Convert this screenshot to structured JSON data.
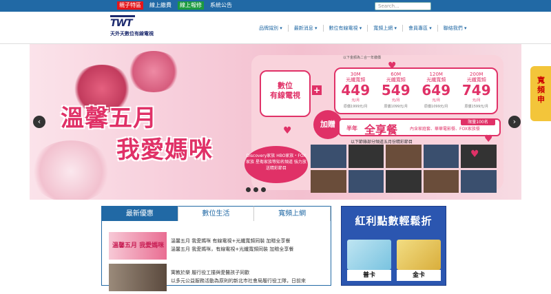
{
  "topbar": {
    "links": [
      "親子特區",
      "線上繳費",
      "線上報修",
      "系統公告"
    ],
    "search_placeholder": "Search..."
  },
  "header": {
    "logo_mark": "TWT",
    "logo_text": "天外天數位有線電視"
  },
  "nav": {
    "items": [
      "品牌識別 ▾",
      "最新消息 ▾",
      "數位有線電視 ▾",
      "寬頻上網 ▾",
      "會員專區 ▾",
      "聯絡我們 ▾"
    ]
  },
  "banner": {
    "title_line1": "溫馨五月",
    "title_line2": "我愛媽咪",
    "price_note": "以下金額為二合一年繳價",
    "digital_label_line1": "數位",
    "digital_label_line2": "有線電視",
    "plus": "+",
    "plans": [
      {
        "speed": "30M",
        "label": "光纖寬頻",
        "price": "449",
        "unit": "元/月",
        "orig": "原價1999元/月"
      },
      {
        "speed": "60M",
        "label": "光纖寬頻",
        "price": "549",
        "unit": "元/月",
        "orig": "原價1099元/月"
      },
      {
        "speed": "120M",
        "label": "光纖寬頻",
        "price": "649",
        "unit": "元/月",
        "orig": "原價1099元/月"
      },
      {
        "speed": "200M",
        "label": "光纖寬頻",
        "price": "749",
        "unit": "元/月",
        "orig": "原價1599元/月"
      }
    ],
    "gift": "加贈",
    "half_year": "半年",
    "package_name": "全享餐",
    "package_desc": "內含家庭套、華華電影餐、FOX家族餐",
    "limited": "限量100名",
    "channel_note": "以下節錄部分頻道五月份精彩節目",
    "discovery_text": "Discovery家族 HBO家族・FOX家族 星衛家族等知名頻道 強力放送精彩節目",
    "side_tab": "寬頻申"
  },
  "tabs": {
    "items": [
      "最新優惠",
      "數位生活",
      "寬頻上網"
    ]
  },
  "news": [
    {
      "thumb_text": "溫馨五月 我愛媽咪",
      "title": "溫馨五月 我愛媽咪 有線電視+光纖寬頻同裝 加贈全享餐",
      "desc": "溫馨五月 我愛媽咪，有線電視+光纖寬頻同裝 加贈全享餐"
    },
    {
      "thumb_text": "",
      "title": "寓教於樂 履行役工撞與愛醫孩子同歡",
      "desc": "以多元公益服務活動為原則的新北市社會局履行役工隊，日前來"
    }
  ],
  "ad": {
    "title": "紅利點數輕鬆折",
    "card_a": "普卡",
    "card_b": "金卡"
  }
}
